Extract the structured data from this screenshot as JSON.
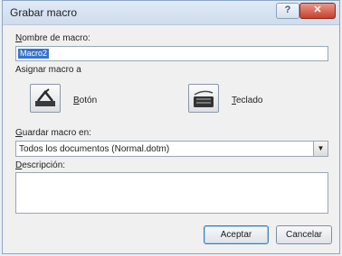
{
  "window": {
    "title": "Grabar macro"
  },
  "titlebar": {
    "help_label": "?",
    "close_label": "✕"
  },
  "form": {
    "name_label_u": "N",
    "name_label_rest": "ombre de macro:",
    "name_value": "Macro2",
    "assign_label": "Asignar macro a",
    "button_label_u": "B",
    "button_label_rest": "otón",
    "keyboard_label_u": "T",
    "keyboard_label_rest": "eclado",
    "store_label_u": "G",
    "store_label_rest": "uardar macro en:",
    "store_value": "Todos los documentos (Normal.dotm)",
    "desc_label_u": "D",
    "desc_label_rest": "escripción:",
    "desc_value": ""
  },
  "buttons": {
    "ok": "Aceptar",
    "cancel": "Cancelar"
  },
  "icons": {
    "button_icon": "button-assign-icon",
    "keyboard_icon": "keyboard-assign-icon"
  },
  "colors": {
    "accent": "#3a73c8",
    "close": "#c7402d"
  }
}
